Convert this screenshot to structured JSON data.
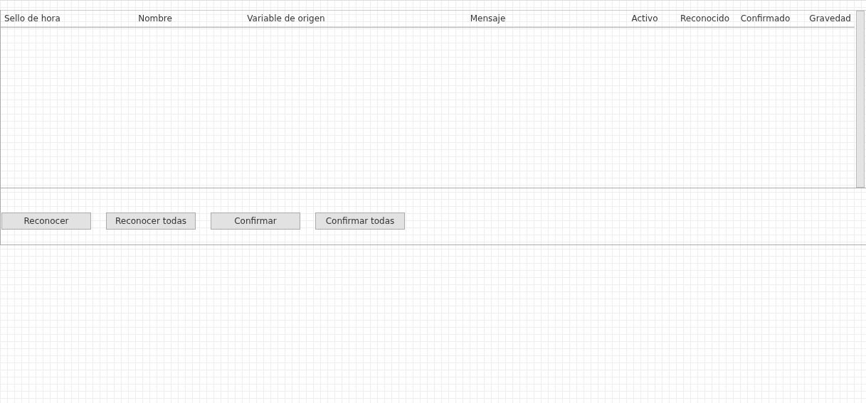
{
  "table": {
    "columns": [
      "Sello de hora",
      "Nombre",
      "Variable de origen",
      "Mensaje",
      "Activo",
      "Reconocido",
      "Confirmado",
      "Gravedad"
    ]
  },
  "buttons": [
    "Reconocer",
    "Reconocer todas",
    "Confirmar",
    "Confirmar todas"
  ]
}
